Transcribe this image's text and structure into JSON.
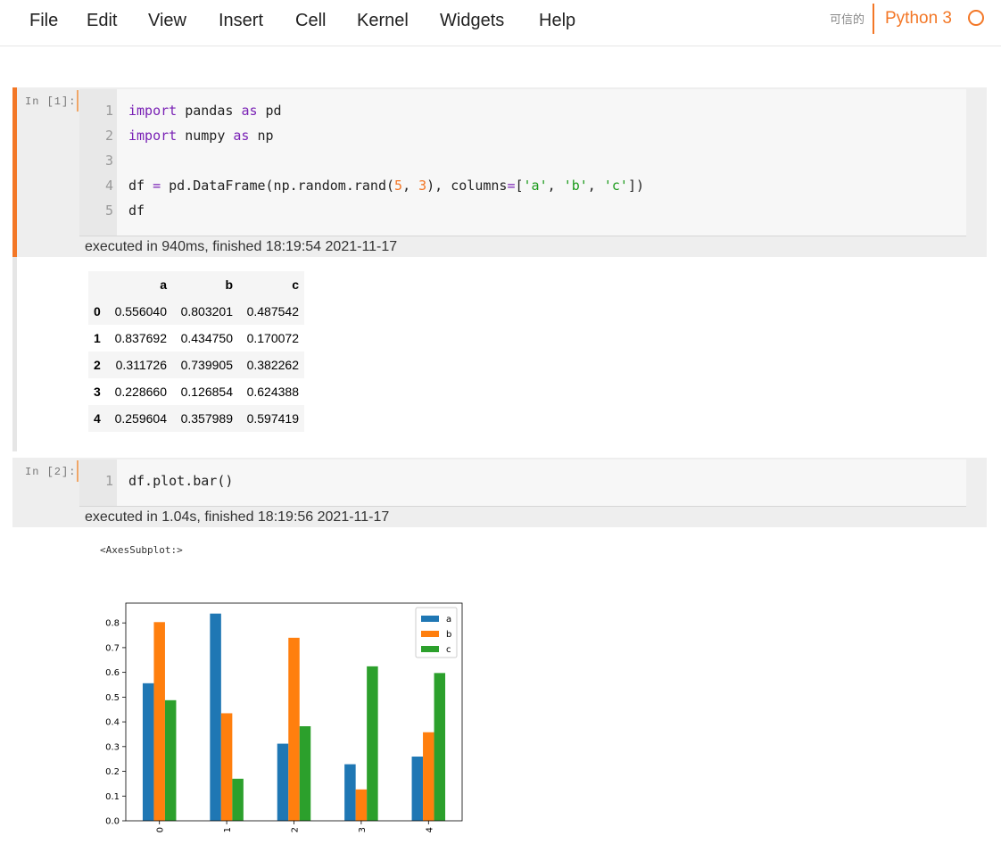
{
  "menu": [
    "File",
    "Edit",
    "View",
    "Insert",
    "Cell",
    "Kernel",
    "Widgets",
    "Help"
  ],
  "trusted_label": "可信的",
  "kernel_name": "Python 3",
  "cells": [
    {
      "prompt": "In  [1]:",
      "line_numbers": [
        "1",
        "2",
        "3",
        "4",
        "5"
      ],
      "exec_info": "executed in 940ms, finished 18:19:54 2021-11-17"
    },
    {
      "prompt": "In  [2]:",
      "line_numbers": [
        "1"
      ],
      "code": "df.plot.bar()",
      "exec_info": "executed in 1.04s, finished 18:19:56 2021-11-17"
    }
  ],
  "dataframe": {
    "columns": [
      "",
      "a",
      "b",
      "c"
    ],
    "rows": [
      {
        "index": "0",
        "values": [
          "0.556040",
          "0.803201",
          "0.487542"
        ]
      },
      {
        "index": "1",
        "values": [
          "0.837692",
          "0.434750",
          "0.170072"
        ]
      },
      {
        "index": "2",
        "values": [
          "0.311726",
          "0.739905",
          "0.382262"
        ]
      },
      {
        "index": "3",
        "values": [
          "0.228660",
          "0.126854",
          "0.624388"
        ]
      },
      {
        "index": "4",
        "values": [
          "0.259604",
          "0.357989",
          "0.597419"
        ]
      }
    ]
  },
  "output_text": "<AxesSubplot:>",
  "chart_data": {
    "type": "bar",
    "categories": [
      "0",
      "1",
      "2",
      "3",
      "4"
    ],
    "series": [
      {
        "name": "a",
        "color": "#1f77b4",
        "values": [
          0.55604,
          0.837692,
          0.311726,
          0.22866,
          0.259604
        ]
      },
      {
        "name": "b",
        "color": "#ff7f0e",
        "values": [
          0.803201,
          0.43475,
          0.739905,
          0.126854,
          0.357989
        ]
      },
      {
        "name": "c",
        "color": "#2ca02c",
        "values": [
          0.487542,
          0.170072,
          0.382262,
          0.624388,
          0.597419
        ]
      }
    ],
    "yticks": [
      "0.0",
      "0.1",
      "0.2",
      "0.3",
      "0.4",
      "0.5",
      "0.6",
      "0.7",
      "0.8"
    ],
    "ylim": [
      0,
      0.88
    ],
    "legend": "top-right",
    "grid": false,
    "x_tick_rotation": 90
  }
}
